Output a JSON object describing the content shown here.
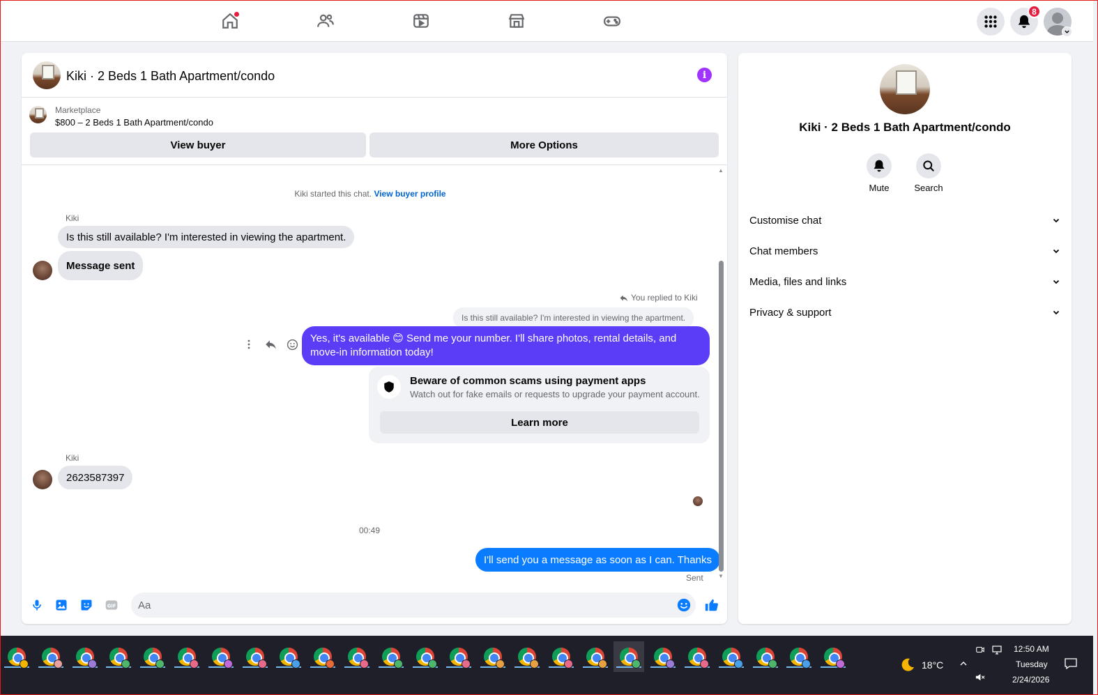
{
  "nav": {
    "icons": [
      "home-icon",
      "friends-icon",
      "watch-icon",
      "marketplace-icon",
      "gaming-icon"
    ],
    "notifications_count": "8"
  },
  "chat": {
    "title": "Kiki · 2 Beds 1 Bath Apartment/condo",
    "marketplace_label": "Marketplace",
    "listing": "$800 – 2 Beds 1 Bath Apartment/condo",
    "view_buyer": "View buyer",
    "more_options": "More Options",
    "started_text": "Kiki started this chat. ",
    "view_buyer_profile": "View buyer profile",
    "sender_name": "Kiki",
    "msg1": "Is this still available? I'm interested in viewing the apartment.",
    "msg2": "Message sent",
    "replied_note": "You replied to Kiki",
    "quoted": "Is this still available? I'm interested in viewing the apartment.",
    "reply_msg": "Yes, it's available 😊 Send me your number. I'll share photos, rental details, and move-in information today!",
    "scam_title": "Beware of common scams using payment apps",
    "scam_text": "Watch out for fake emails or requests to upgrade your payment account.",
    "learn_more": "Learn more",
    "sender_name_2": "Kiki",
    "msg3": "2623587397",
    "time": "00:49",
    "final_msg": "I'll send you a message as soon as I can. Thanks",
    "sent_label": "Sent",
    "input_placeholder": "Aa"
  },
  "panel": {
    "title": "Kiki · 2 Beds 1 Bath Apartment/condo",
    "mute": "Mute",
    "search": "Search",
    "rows": [
      "Customise chat",
      "Chat members",
      "Media, files and links",
      "Privacy & support"
    ]
  },
  "taskbar": {
    "weather": "18°C",
    "time": "12:50 AM",
    "day": "Tuesday",
    "date": "2/24/2026"
  },
  "colors": {
    "accent_purple": "#5b3cf7",
    "messenger_blue": "#0a7cff",
    "link_blue": "#0064d1"
  }
}
